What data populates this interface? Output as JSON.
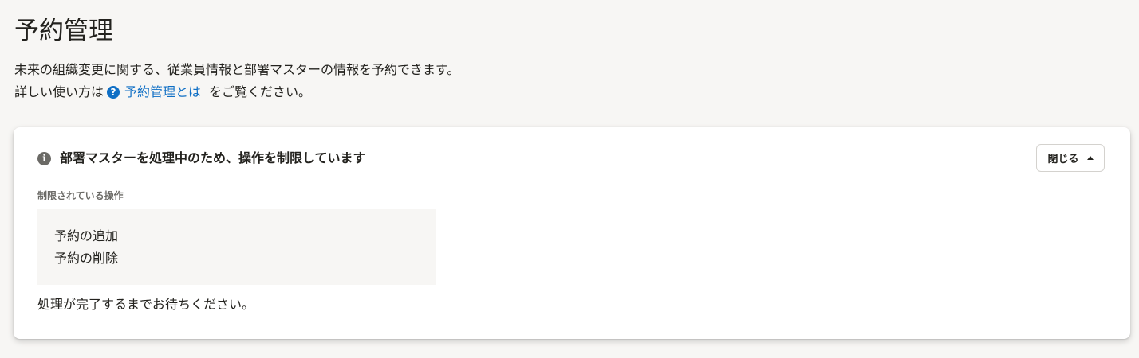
{
  "header": {
    "title": "予約管理",
    "description_line1": "未来の組織変更に関する、従業員情報と部署マスターの情報を予約できます。",
    "description_line2_prefix": "詳しい使い方は",
    "help_icon": "question-circle-icon",
    "help_link_text": "予約管理とは",
    "description_line2_suffix": "をご覧ください。"
  },
  "notice": {
    "icon": "info-circle-icon",
    "title": "部署マスターを処理中のため、操作を制限しています",
    "close_label": "閉じる",
    "close_icon": "caret-up-icon",
    "restricted_label": "制限されている操作",
    "restricted_operations": [
      "予約の追加",
      "予約の削除"
    ],
    "footer_message": "処理が完了するまでお待ちください。"
  },
  "colors": {
    "background": "#f7f6f4",
    "text": "#23221e",
    "link": "#0f6fc5",
    "muted": "#6b6a66",
    "card": "#ffffff"
  }
}
